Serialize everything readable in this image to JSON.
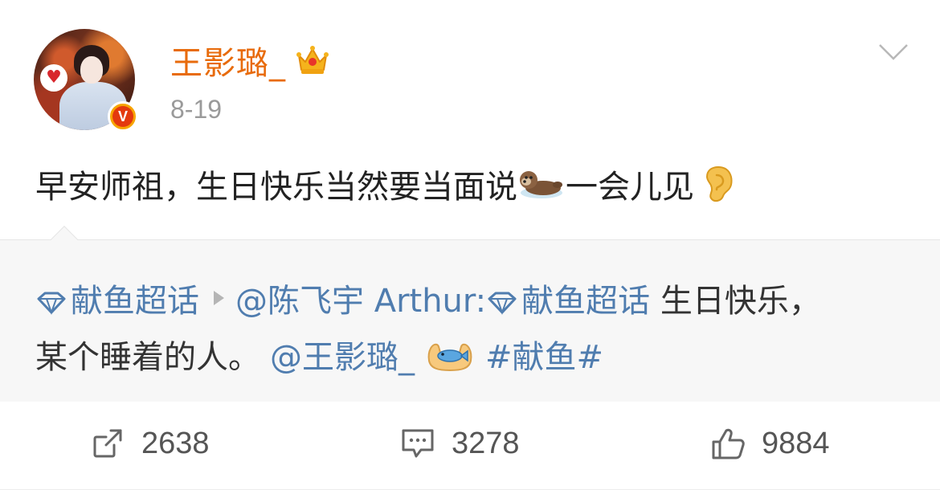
{
  "header": {
    "username": "王影璐_",
    "timestamp": "8-19",
    "verified_badge": "V",
    "icons": [
      "crown-icon",
      "chevron-down-icon",
      "verified-badge"
    ]
  },
  "post": {
    "text_part1": "早安师祖，生日快乐当然要当面说",
    "text_part2": "一会儿见",
    "emojis": [
      "otter-emoji",
      "ear-emoji"
    ]
  },
  "repost": {
    "topic1": "献鱼超话",
    "mention_author": "@陈飞宇 Arthur:",
    "topic2": "献鱼超话",
    "text1": " 生日快乐，",
    "text2": "某个睡着的人。",
    "mention_user": "@王影璐_",
    "hashtag": "#献鱼#",
    "emojis": [
      "palms-up-emoji",
      "fish-emoji"
    ]
  },
  "actions": {
    "repost_count": "2638",
    "comment_count": "3278",
    "like_count": "9884"
  },
  "colors": {
    "username": "#e86b0c",
    "link": "#507daf",
    "text": "#222222",
    "muted": "#9a9a9a",
    "repost_bg": "#f7f7f7",
    "badge": "#f7a400"
  }
}
